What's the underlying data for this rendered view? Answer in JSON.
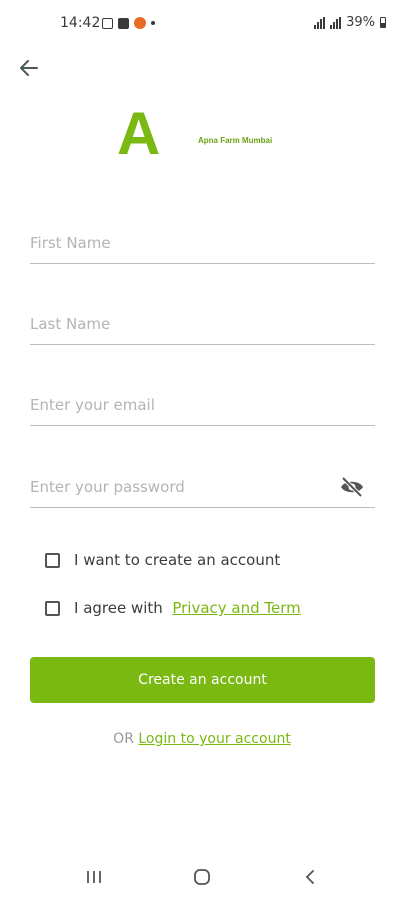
{
  "status_bar": {
    "time": "14:42",
    "battery": "39%"
  },
  "logo": {
    "letter": "A",
    "name": "Apna Farm Mumbai"
  },
  "form": {
    "first_name_placeholder": "First Name",
    "last_name_placeholder": "Last Name",
    "email_placeholder": "Enter your email",
    "password_placeholder": "Enter your password",
    "create_account_checkbox_label": "I want to create an account",
    "agree_label": "I agree with",
    "privacy_link": "Privacy and Term",
    "create_button": "Create an account"
  },
  "footer": {
    "or": "OR",
    "login_link": "Login to your account"
  },
  "colors": {
    "accent": "#7ab812",
    "text": "#3d3d3d",
    "placeholder": "#b4b4b4"
  },
  "icons": [
    "back-arrow-icon",
    "eye-off-icon",
    "recents-icon",
    "home-icon",
    "back-nav-icon"
  ]
}
